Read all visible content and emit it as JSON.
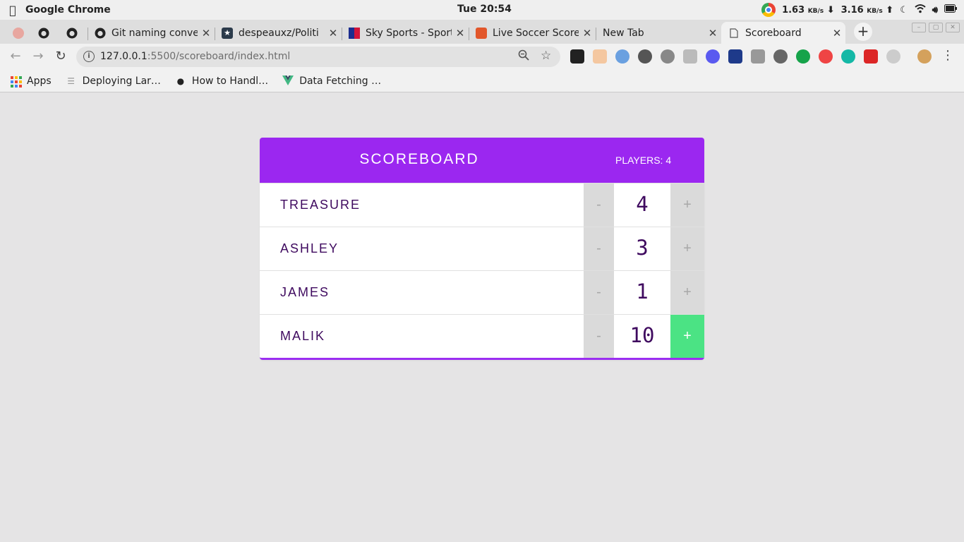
{
  "os": {
    "app_name": "Google Chrome",
    "clock": "Tue 20:54",
    "download_rate": "1.63",
    "download_unit": "KB/s",
    "upload_rate": "3.16",
    "upload_unit": "KB/s"
  },
  "tabs": [
    {
      "title": "",
      "icon": "shield-extension-icon",
      "close": ""
    },
    {
      "title": "",
      "icon": "github-icon",
      "close": ""
    },
    {
      "title": "",
      "icon": "github-icon",
      "close": ""
    },
    {
      "title": "Git naming conve",
      "icon": "github-icon",
      "close": "✕"
    },
    {
      "title": "despeauxz/Politi",
      "icon": "star-square-icon",
      "close": "✕"
    },
    {
      "title": "Sky Sports - Sport",
      "icon": "sky-sports-icon",
      "close": "✕"
    },
    {
      "title": "Live Soccer Score",
      "icon": "soccer-icon",
      "close": "✕"
    },
    {
      "title": "New Tab",
      "icon": "",
      "close": "✕"
    },
    {
      "title": "Scoreboard",
      "icon": "page-icon",
      "close": "✕"
    }
  ],
  "toolbar": {
    "url_host": "127.0.0.1",
    "url_path": ":5500/scoreboard/index.html"
  },
  "bookmarks": [
    {
      "label": "Apps",
      "icon": "apps-grid-icon"
    },
    {
      "label": "Deploying Lar…",
      "icon": "bookmark-lines-icon"
    },
    {
      "label": "How to Handl…",
      "icon": "avatar-icon"
    },
    {
      "label": "Data Fetching …",
      "icon": "vue-icon"
    }
  ],
  "scoreboard": {
    "title": "SCOREBOARD",
    "stats": "PLAYERS: 4",
    "decrement_label": "-",
    "increment_label": "+",
    "players": [
      {
        "name": "TREASURE",
        "score": "4"
      },
      {
        "name": "ASHLEY",
        "score": "3"
      },
      {
        "name": "JAMES",
        "score": "1"
      },
      {
        "name": "MALIK",
        "score": "10"
      }
    ]
  },
  "colors": {
    "header_purple": "#9b27f0",
    "name_text": "#3f0a5f",
    "increment_hover_green": "#4be384",
    "button_gray": "#dadada",
    "page_background": "#e5e4e5"
  }
}
